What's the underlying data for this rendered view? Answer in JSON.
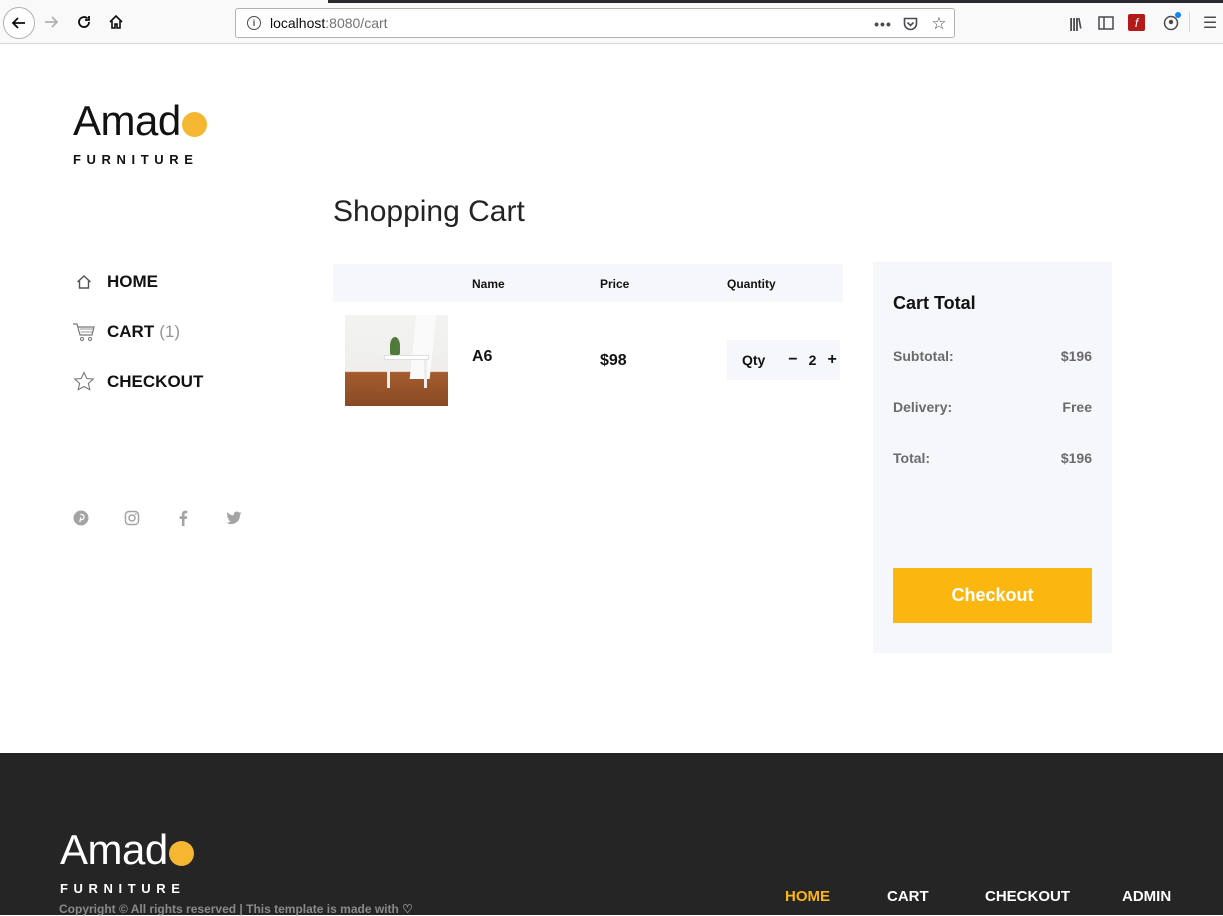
{
  "browser": {
    "url_host": "localhost",
    "url_rest": ":8080/cart",
    "back_icon": "arrow-left-icon",
    "forward_icon": "arrow-right-icon",
    "reload_icon": "reload-icon",
    "home_icon": "home-icon"
  },
  "brand": {
    "name": "Amad",
    "tagline": "FURNITURE",
    "accent": "#f5b732"
  },
  "sidebar": {
    "items": [
      {
        "label": "HOME",
        "icon": "home-icon",
        "count": ""
      },
      {
        "label": "CART",
        "icon": "cart-icon",
        "count": "(1)"
      },
      {
        "label": "CHECKOUT",
        "icon": "star-icon",
        "count": ""
      }
    ],
    "social": [
      "pinterest-icon",
      "instagram-icon",
      "facebook-icon",
      "twitter-icon"
    ]
  },
  "cart": {
    "title": "Shopping Cart",
    "columns": [
      "",
      "Name",
      "Price",
      "Quantity"
    ],
    "items": [
      {
        "name": "A6",
        "price": "$98",
        "qty_label": "Qty",
        "qty": "2"
      }
    ]
  },
  "summary": {
    "title": "Cart Total",
    "subtotal_label": "Subtotal:",
    "subtotal": "$196",
    "delivery_label": "Delivery:",
    "delivery": "Free",
    "total_label": "Total:",
    "total": "$196",
    "checkout_label": "Checkout",
    "button_color": "#fbb710"
  },
  "footer": {
    "copyright": "Copyright © All rights reserved | This template is made with ♡",
    "nav": [
      "HOME",
      "CART",
      "CHECKOUT",
      "ADMIN"
    ],
    "active_color": "#fbb710"
  }
}
